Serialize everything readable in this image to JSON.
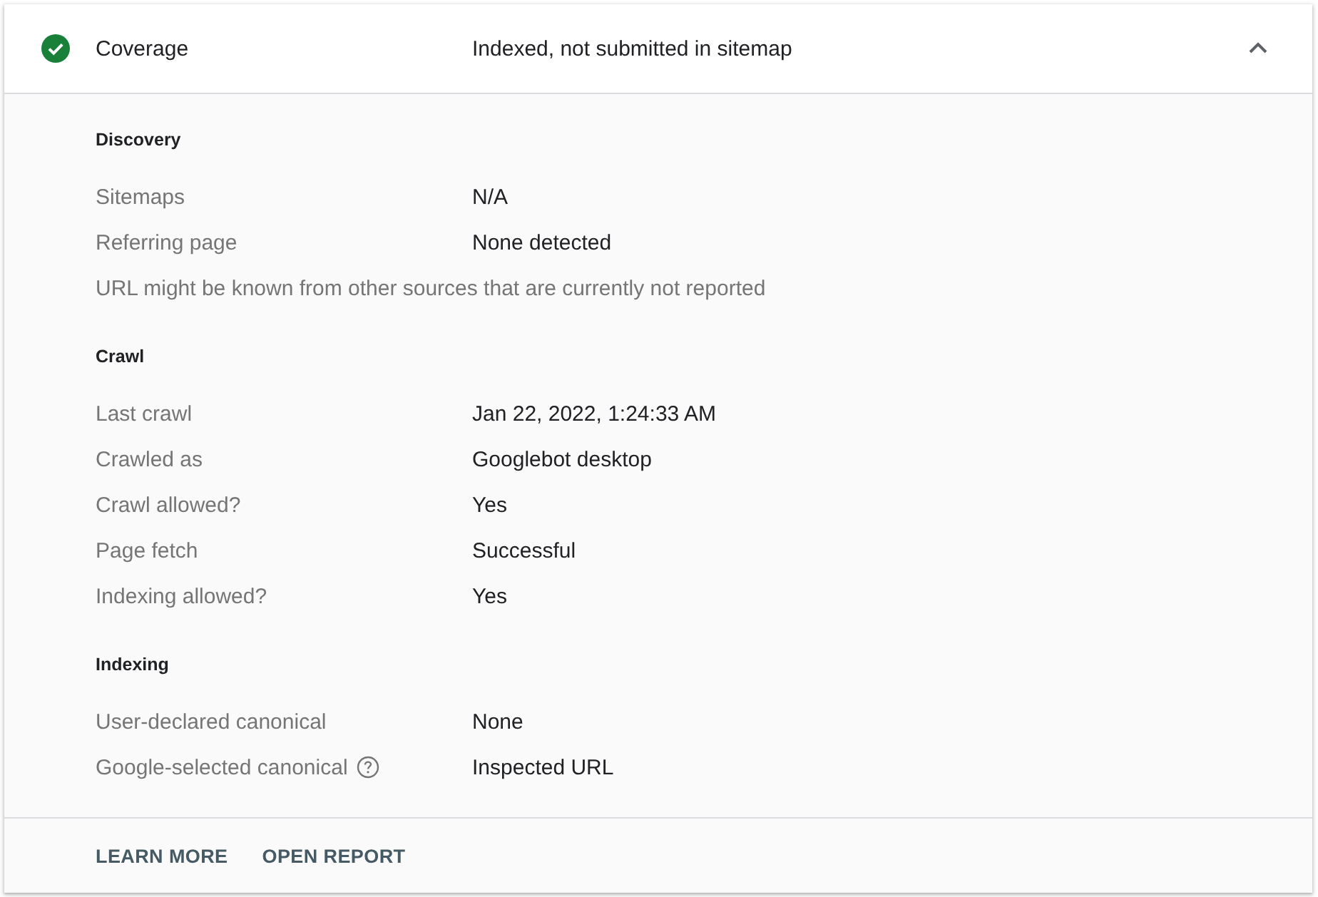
{
  "header": {
    "valid": true,
    "title": "Coverage",
    "value": "Indexed, not submitted in sitemap",
    "expanded": true
  },
  "sections": [
    {
      "heading": "Discovery",
      "rows": [
        {
          "kind": "pair",
          "label": "Sitemaps",
          "value": "N/A",
          "help": false
        },
        {
          "kind": "pair",
          "label": "Referring page",
          "value": "None detected",
          "help": false
        },
        {
          "kind": "note",
          "text": "URL might be known from other sources that are currently not reported"
        }
      ]
    },
    {
      "heading": "Crawl",
      "rows": [
        {
          "kind": "pair",
          "label": "Last crawl",
          "value": "Jan 22, 2022, 1:24:33 AM",
          "help": false
        },
        {
          "kind": "pair",
          "label": "Crawled as",
          "value": "Googlebot desktop",
          "help": false
        },
        {
          "kind": "pair",
          "label": "Crawl allowed?",
          "value": "Yes",
          "help": false
        },
        {
          "kind": "pair",
          "label": "Page fetch",
          "value": "Successful",
          "help": false
        },
        {
          "kind": "pair",
          "label": "Indexing allowed?",
          "value": "Yes",
          "help": false
        }
      ]
    },
    {
      "heading": "Indexing",
      "rows": [
        {
          "kind": "pair",
          "label": "User-declared canonical",
          "value": "None",
          "help": false
        },
        {
          "kind": "pair",
          "label": "Google-selected canonical",
          "value": "Inspected URL",
          "help": true
        }
      ]
    }
  ],
  "actions": [
    "LEARN MORE",
    "OPEN REPORT"
  ]
}
